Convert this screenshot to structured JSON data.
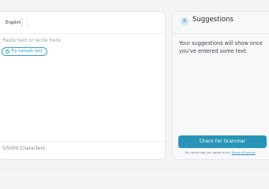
{
  "editor": {
    "language": "English",
    "placeholder": "Paste text or write here",
    "sample_button": "Try sample text",
    "character_count": "0/5000 Characters"
  },
  "suggestions": {
    "count": "0",
    "title": "Suggestions",
    "message": "Your suggestions will show once you've entered some text.",
    "check_button": "Check For Grammar",
    "agreement_prefix": "By continuing you agree to our",
    "terms_link": "Terms of Service"
  },
  "colors": {
    "accent": "#2894b7",
    "badge_bg": "#cde6ee"
  }
}
